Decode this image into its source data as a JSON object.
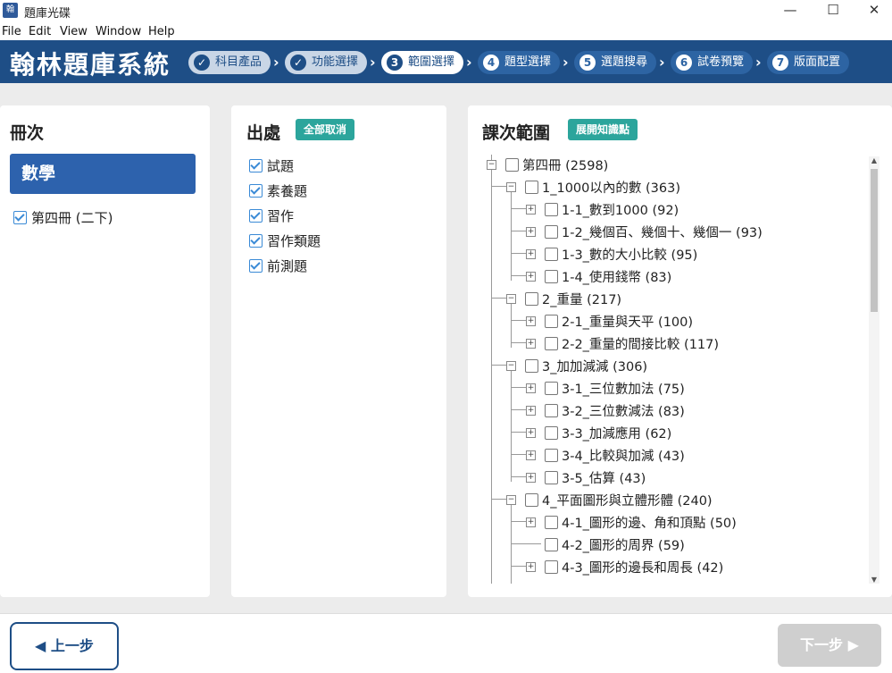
{
  "window": {
    "app_icon_text": "翰林",
    "title": "題庫光碟",
    "minimize": "—",
    "maximize": "☐",
    "close": "✕"
  },
  "menu": [
    "File",
    "Edit",
    "View",
    "Window",
    "Help"
  ],
  "header": {
    "brand": "翰林題庫系統",
    "steps": [
      {
        "num": "✓",
        "label": "科目產品",
        "state": "done"
      },
      {
        "num": "✓",
        "label": "功能選擇",
        "state": "done"
      },
      {
        "num": "3",
        "label": "範圍選擇",
        "state": "active"
      },
      {
        "num": "4",
        "label": "題型選擇",
        "state": "todo"
      },
      {
        "num": "5",
        "label": "選題搜尋",
        "state": "todo"
      },
      {
        "num": "6",
        "label": "試卷預覽",
        "state": "todo"
      },
      {
        "num": "7",
        "label": "版面配置",
        "state": "todo"
      }
    ],
    "arrow": "›"
  },
  "book_panel": {
    "title": "冊次",
    "subject": "數學",
    "book": {
      "label": "第四冊 (二下)",
      "checked": true
    }
  },
  "source_panel": {
    "title": "出處",
    "deselect_all": "全部取消",
    "items": [
      {
        "label": "試題",
        "checked": true
      },
      {
        "label": "素養題",
        "checked": true
      },
      {
        "label": "習作",
        "checked": true
      },
      {
        "label": "習作類題",
        "checked": true
      },
      {
        "label": "前測題",
        "checked": true
      }
    ]
  },
  "range_panel": {
    "title": "課次範圍",
    "expand_knowledge": "展開知識點",
    "tree": [
      {
        "label": "第四冊 (2598)",
        "level": 0,
        "expander": "minus"
      },
      {
        "label": "1_1000以內的數 (363)",
        "level": 1,
        "expander": "minus"
      },
      {
        "label": "1-1_數到1000 (92)",
        "level": 2,
        "expander": "plus"
      },
      {
        "label": "1-2_幾個百、幾個十、幾個一 (93)",
        "level": 2,
        "expander": "plus"
      },
      {
        "label": "1-3_數的大小比較 (95)",
        "level": 2,
        "expander": "plus"
      },
      {
        "label": "1-4_使用錢幣 (83)",
        "level": 2,
        "expander": "plus"
      },
      {
        "label": "2_重量 (217)",
        "level": 1,
        "expander": "minus"
      },
      {
        "label": "2-1_重量與天平 (100)",
        "level": 2,
        "expander": "plus"
      },
      {
        "label": "2-2_重量的間接比較 (117)",
        "level": 2,
        "expander": "plus"
      },
      {
        "label": "3_加加減減 (306)",
        "level": 1,
        "expander": "minus"
      },
      {
        "label": "3-1_三位數加法 (75)",
        "level": 2,
        "expander": "plus"
      },
      {
        "label": "3-2_三位數減法 (83)",
        "level": 2,
        "expander": "plus"
      },
      {
        "label": "3-3_加減應用 (62)",
        "level": 2,
        "expander": "plus"
      },
      {
        "label": "3-4_比較與加減 (43)",
        "level": 2,
        "expander": "plus"
      },
      {
        "label": "3-5_估算 (43)",
        "level": 2,
        "expander": "plus"
      },
      {
        "label": "4_平面圖形與立體形體 (240)",
        "level": 1,
        "expander": "minus"
      },
      {
        "label": "4-1_圖形的邊、角和頂點 (50)",
        "level": 2,
        "expander": "plus"
      },
      {
        "label": "4-2_圖形的周界 (59)",
        "level": 2,
        "expander": "none"
      },
      {
        "label": "4-3_圖形的邊長和周長 (42)",
        "level": 2,
        "expander": "plus"
      }
    ]
  },
  "footer": {
    "prev": "◀ 上一步",
    "next": "下一步 ▶"
  }
}
